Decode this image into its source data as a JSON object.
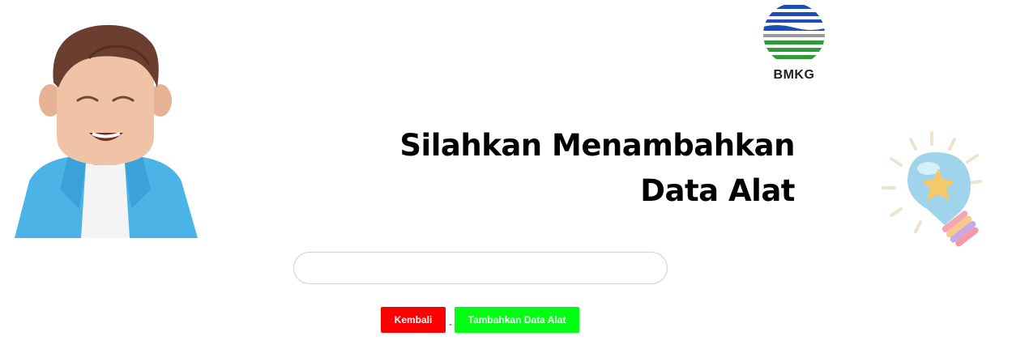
{
  "logo": {
    "text": "BMKG",
    "colors": {
      "blue": "#1a4fb4",
      "green": "#2f9c3a",
      "gray": "#9a9a9a"
    }
  },
  "heading": {
    "line1": "Silahkan Menambahkan",
    "line2": "Data Alat"
  },
  "form": {
    "input_value": "",
    "input_placeholder": ""
  },
  "buttons": {
    "back_label": "Kembali",
    "separator": "-",
    "add_label": "Tambahkan Data Alat",
    "back_color": "#ff0000",
    "add_color": "#00ff13"
  },
  "illustrations": {
    "left": "cartoon-man-icon",
    "right": "lightbulb-star-icon"
  }
}
